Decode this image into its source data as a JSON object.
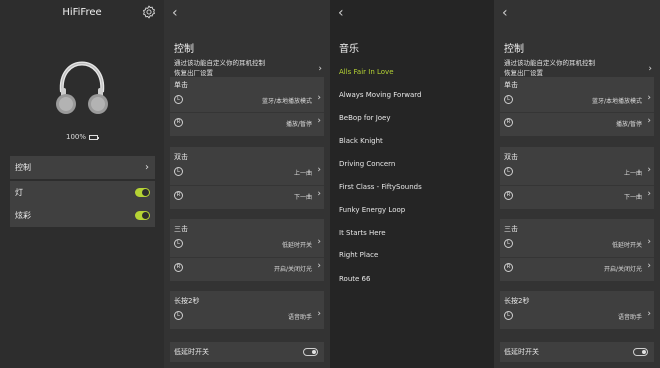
{
  "device": {
    "name": "HiFiFree",
    "battery": "100%"
  },
  "home_menu": [
    {
      "label": "控制",
      "kind": "chevron"
    },
    {
      "label": "灯",
      "kind": "toggle",
      "on": true
    },
    {
      "label": "炫彩",
      "kind": "toggle",
      "on": true
    }
  ],
  "control": {
    "title": "控制",
    "subtitle": "通过该功能自定义你的耳机控制",
    "reset": "恢复出厂设置",
    "left_badge": "L",
    "right_badge": "R",
    "groups": [
      {
        "title": "单击",
        "left": "蓝牙/本地播放模式",
        "right": "播放/暂停"
      },
      {
        "title": "双击",
        "left": "上一曲",
        "right": "下一曲"
      },
      {
        "title": "三击",
        "left": "低延时开关",
        "right": "开启/关闭灯光"
      },
      {
        "title": "长按2秒",
        "left": "语音助手"
      }
    ],
    "latency_label": "低延时开关",
    "latency_on": false
  },
  "music": {
    "title": "音乐",
    "songs": [
      "Alls Fair In Love",
      "Always Moving Forward",
      "BeBop for Joey",
      "Black Knight",
      "Driving Concern",
      "First Class - FiftySounds",
      "Funky Energy Loop",
      "It Starts Here",
      "Right Place",
      "Route 66"
    ],
    "active_index": 0,
    "accent": "#b5d334"
  },
  "icons": {
    "back": "chevron-left-icon",
    "settings": "gear-icon",
    "battery": "battery-icon"
  }
}
